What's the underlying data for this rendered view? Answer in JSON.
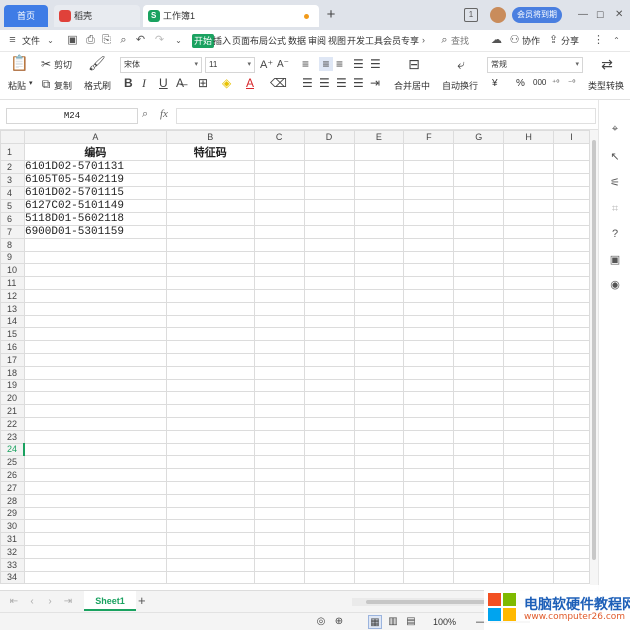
{
  "tabs": {
    "home": "首页",
    "daoke": "稻壳",
    "workbook": "工作簿1"
  },
  "titlebar": {
    "badge": "1",
    "member_button": "会员将到期"
  },
  "menu": {
    "file": "文件",
    "start": "开始",
    "items": [
      "插入",
      "页面布局",
      "公式",
      "数据",
      "审阅",
      "视图",
      "开发工具",
      "会员专享"
    ],
    "search": "查找",
    "collaborate": "协作",
    "share": "分享"
  },
  "ribbon": {
    "cut": "剪切",
    "copy": "复制",
    "paste": "粘贴",
    "format_painter": "格式刷",
    "font_name": "宋体",
    "font_size": "11",
    "merge_center": "合并居中",
    "auto_wrap": "自动换行",
    "number_format": "常规",
    "type_convert": "类型转换",
    "currency": "¥",
    "percent": "%"
  },
  "formula_bar": {
    "cell_ref": "M24",
    "fx": "fx",
    "value": ""
  },
  "sheet": {
    "columns": [
      "A",
      "B",
      "C",
      "D",
      "E",
      "F",
      "G",
      "H",
      "I"
    ],
    "header_row": {
      "a": "编码",
      "b": "特征码"
    },
    "codes": [
      "6101D02-5701131",
      "6105T05-5402119",
      "6101D02-5701115",
      "6127C02-5101149",
      "5118D01-5602118",
      "6900D01-5301159"
    ],
    "row_count": 34,
    "active_row": 24
  },
  "sheet_tabs": {
    "active": "Sheet1",
    "add": "+"
  },
  "status": {
    "zoom": "100%",
    "minus": "—"
  },
  "watermark": {
    "name": "电脑软硬件教程网",
    "url": "www.computer26.com"
  },
  "colors": {
    "accent_green": "#1aa260",
    "home_tab_blue": "#3e7ce6",
    "member_blue": "#4a7fe0"
  }
}
